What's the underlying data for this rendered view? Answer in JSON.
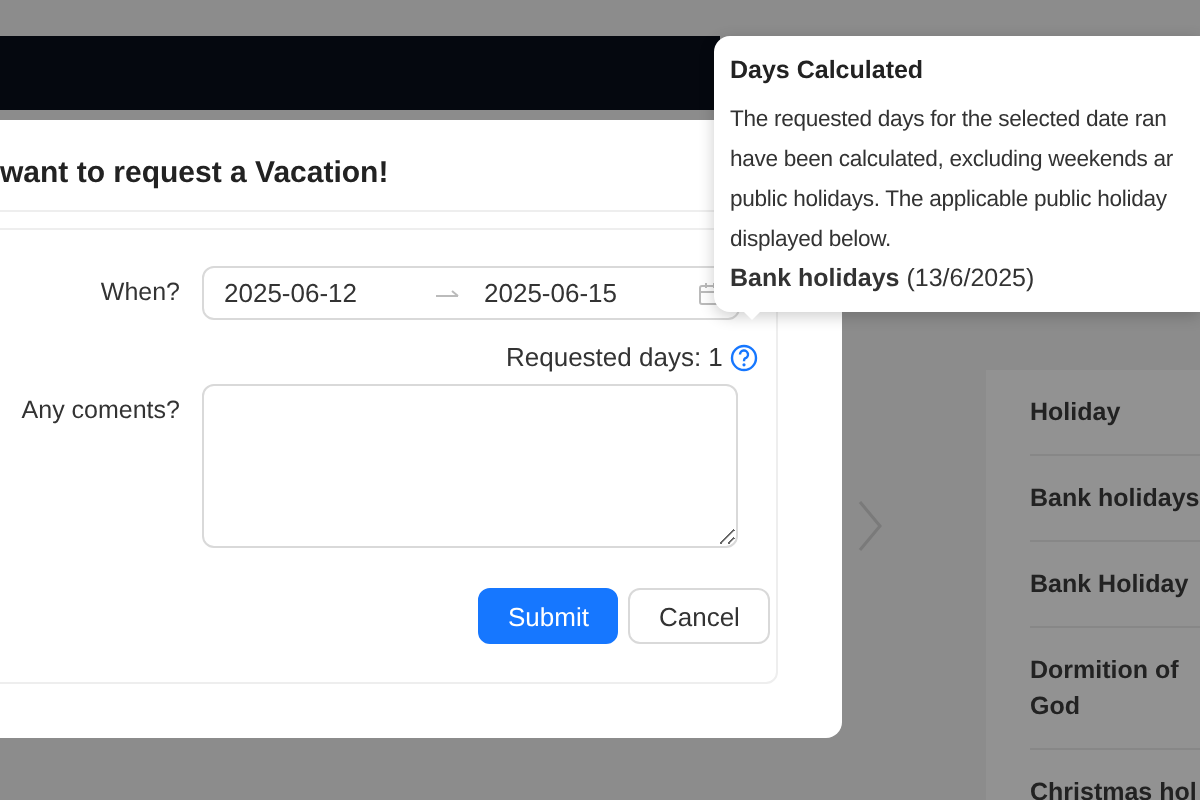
{
  "modal": {
    "title": "want to request a Vacation!",
    "when": {
      "label": "When?",
      "start": "2025-06-12",
      "end": "2025-06-15"
    },
    "requested_days": "Requested days: 1",
    "comments": {
      "label": "Any coments?"
    },
    "buttons": [
      {
        "label": "Submit",
        "kind": "primary"
      },
      {
        "label": "Cancel",
        "kind": "default"
      }
    ]
  },
  "tooltip": {
    "title": "Days Calculated",
    "lines": [
      "The requested days for the selected date ran",
      "have been calculated, excluding weekends ar",
      "public holidays. The applicable public holiday",
      "displayed below."
    ],
    "holiday": {
      "name": "Bank holidays",
      "date": "(13/6/2025)"
    }
  },
  "holiday_list": [
    {
      "name": "Holiday"
    },
    {
      "name": "Bank holidays"
    },
    {
      "name": "Bank Holiday"
    },
    {
      "name": "Dormition of God"
    },
    {
      "name": "Christmas hol"
    }
  ]
}
